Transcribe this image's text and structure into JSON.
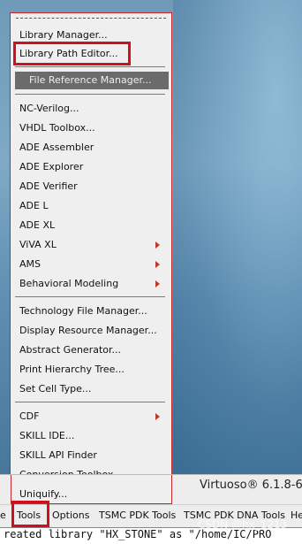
{
  "menu": {
    "items": [
      {
        "label": "Library Manager..."
      },
      {
        "label": "Library Path Editor..."
      },
      {
        "label": "File Reference Manager..."
      },
      {
        "label": "NC-Verilog..."
      },
      {
        "label": "VHDL Toolbox..."
      },
      {
        "label": "ADE Assembler"
      },
      {
        "label": "ADE Explorer"
      },
      {
        "label": "ADE Verifier"
      },
      {
        "label": "ADE L"
      },
      {
        "label": "ADE XL"
      },
      {
        "label": "ViVA XL"
      },
      {
        "label": "AMS"
      },
      {
        "label": "Behavioral Modeling"
      },
      {
        "label": "Technology File Manager..."
      },
      {
        "label": "Display Resource Manager..."
      },
      {
        "label": "Abstract Generator..."
      },
      {
        "label": "Print Hierarchy Tree..."
      },
      {
        "label": "Set Cell Type..."
      },
      {
        "label": "CDF"
      },
      {
        "label": "SKILL IDE..."
      },
      {
        "label": "SKILL API Finder"
      },
      {
        "label": "Conversion Toolbox..."
      },
      {
        "label": "Uniquify..."
      }
    ]
  },
  "window": {
    "title": "Virtuoso® 6.1.8-6"
  },
  "menubar": {
    "items": [
      {
        "label": "e"
      },
      {
        "label": "Tools"
      },
      {
        "label": "Options"
      },
      {
        "label": "TSMC PDK Tools"
      },
      {
        "label": "TSMC PDK DNA Tools"
      },
      {
        "label": "He"
      }
    ]
  },
  "console": {
    "text": "reated library \"HX_STONE\" as \"/home/IC/PRO"
  },
  "watermark": {
    "text": "CSDN @hx_1213"
  },
  "colors": {
    "highlight_box": "#d0101c",
    "menu_bg": "#efefef",
    "selected_item": "#6b6b6b"
  }
}
